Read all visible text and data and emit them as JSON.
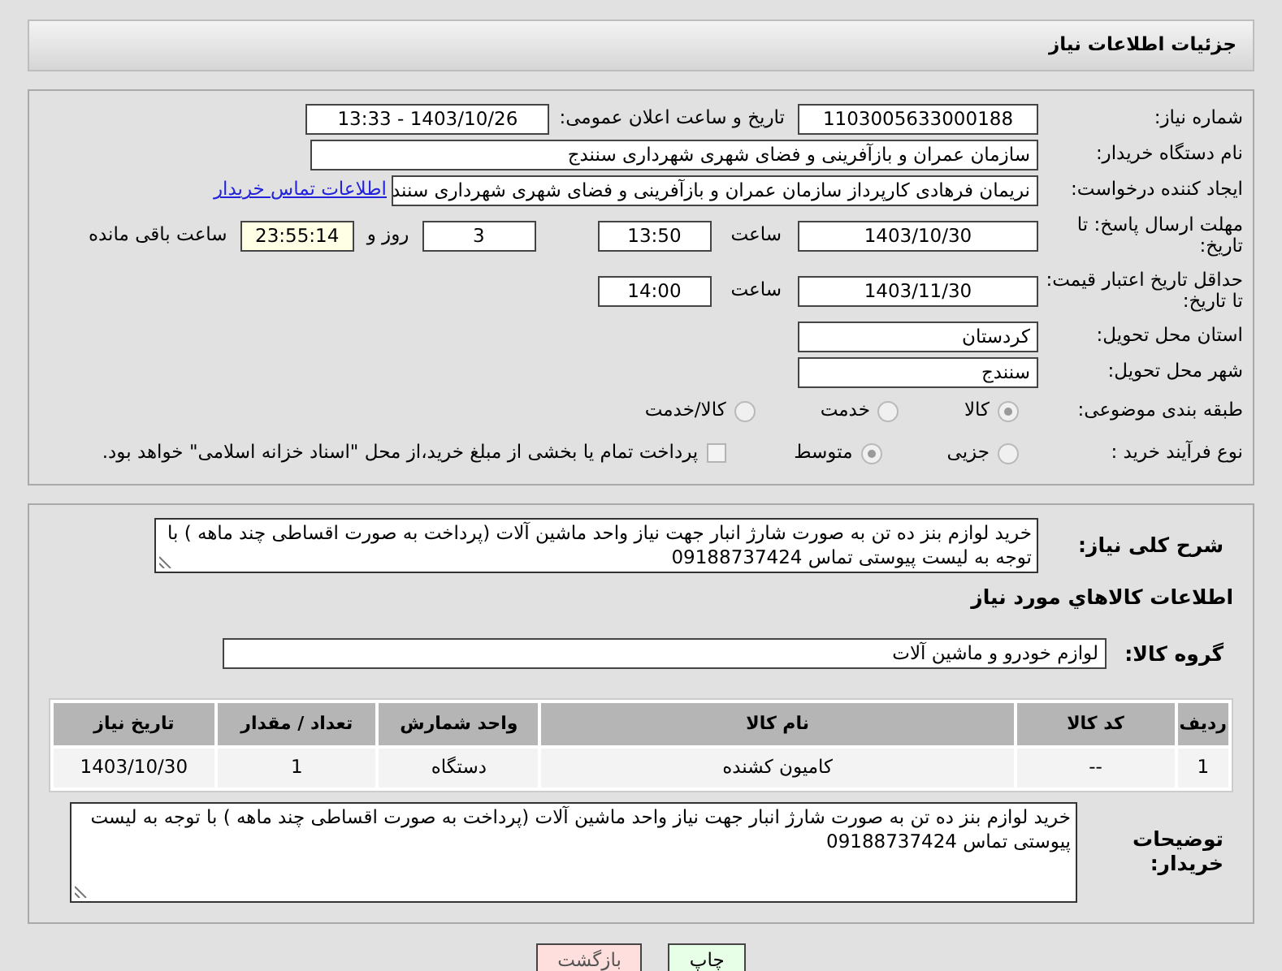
{
  "header": {
    "title": "جزئیات اطلاعات نیاز"
  },
  "need_number": {
    "label": "شماره نیاز:",
    "value": "1103005633000188"
  },
  "announce": {
    "label": "تاریخ و ساعت اعلان عمومی:",
    "value": "1403/10/26 - 13:33"
  },
  "buyer_org": {
    "label": "نام دستگاه خریدار:",
    "value": "سازمان عمران و بازآفرینی و فضای شهری شهرداری سنندج"
  },
  "requester": {
    "label": "ایجاد کننده درخواست:",
    "value": "نریمان فرهادی کارپرداز سازمان عمران و بازآفرینی و فضای شهری شهرداری سنند",
    "contact_link": "اطلاعات تماس خریدار"
  },
  "reply_deadline": {
    "label": "مهلت ارسال پاسخ: تا تاریخ:",
    "date": "1403/10/30",
    "time_label": "ساعت",
    "time": "13:50",
    "days": "3",
    "days_label": "روز و",
    "remaining": "23:55:14",
    "remaining_label": "ساعت باقی مانده"
  },
  "price_validity": {
    "label": "حداقل تاریخ اعتبار قیمت: تا تاریخ:",
    "date": "1403/11/30",
    "time_label": "ساعت",
    "time": "14:00"
  },
  "province": {
    "label": "استان محل تحویل:",
    "value": "کردستان"
  },
  "city": {
    "label": "شهر محل تحویل:",
    "value": "سنندج"
  },
  "category": {
    "label": "طبقه بندی موضوعی:",
    "options": [
      {
        "label": "کالا",
        "selected": true
      },
      {
        "label": "خدمت",
        "selected": false
      },
      {
        "label": "کالا/خدمت",
        "selected": false
      }
    ]
  },
  "purchase_type": {
    "label": "نوع فرآیند خرید :",
    "options": [
      {
        "label": "جزیی",
        "selected": false
      },
      {
        "label": "متوسط",
        "selected": true
      }
    ],
    "treasury": {
      "checked": false,
      "text": "پرداخت تمام یا بخشی از مبلغ خرید،از محل \"اسناد خزانه اسلامی\" خواهد بود."
    }
  },
  "description": {
    "label": "شرح کلی نیاز:",
    "value": "خرید لوازم بنز ده تن به صورت شارژ انبار جهت نیاز واحد ماشین آلات (پرداخت به صورت اقساطی چند ماهه ) با توجه به لیست پیوستی تماس 09188737424"
  },
  "goods_heading": "اطلاعات کالاهاي مورد نياز",
  "goods_group": {
    "label": "گروه کالا:",
    "value": "لوازم خودرو و ماشین آلات"
  },
  "table": {
    "columns": [
      "ردیف",
      "کد کالا",
      "نام کالا",
      "واحد شمارش",
      "تعداد / مقدار",
      "تاریخ نیاز"
    ],
    "rows": [
      [
        "1",
        "--",
        "کامیون کشنده",
        "دستگاه",
        "1",
        "1403/10/30"
      ]
    ]
  },
  "buyer_notes": {
    "label": "توضیحات خریدار:",
    "value": "خرید لوازم بنز ده تن به صورت شارژ انبار جهت نیاز واحد ماشین آلات (پرداخت به صورت اقساطی چند ماهه ) با توجه به لیست پیوستی تماس 09188737424"
  },
  "buttons": [
    {
      "label": "چاپ",
      "kind": "print"
    },
    {
      "label": "بازگشت",
      "kind": "back"
    }
  ]
}
